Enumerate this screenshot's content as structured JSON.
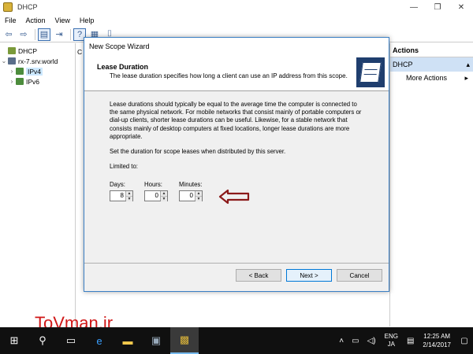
{
  "window": {
    "title": "DHCP",
    "controls": [
      "—",
      "❐",
      "✕"
    ]
  },
  "menu": [
    "File",
    "Action",
    "View",
    "Help"
  ],
  "tree": {
    "root": "DHCP",
    "server": "rx-7.srv.world",
    "children": [
      "IPv4",
      "IPv6"
    ]
  },
  "middle": {
    "header": "C"
  },
  "actions": {
    "title": "Actions",
    "section": "DHCP",
    "item": "More Actions"
  },
  "wizard": {
    "title": "New Scope Wizard",
    "heading": "Lease Duration",
    "subheading": "The lease duration specifies how long a client can use an IP address from this scope.",
    "paragraph1": "Lease durations should typically be equal to the average time the computer is connected to the same physical network. For mobile networks that consist mainly of portable computers or dial-up clients, shorter lease durations can be useful. Likewise, for a stable network that consists mainly of desktop computers at fixed locations, longer lease durations are more appropriate.",
    "paragraph2": "Set the duration for scope leases when distributed by this server.",
    "limited": "Limited to:",
    "fields": [
      {
        "label": "Days:",
        "value": "8"
      },
      {
        "label": "Hours:",
        "value": "0"
      },
      {
        "label": "Minutes:",
        "value": "0"
      }
    ],
    "buttons": {
      "back": "< Back",
      "next": "Next >",
      "cancel": "Cancel"
    }
  },
  "watermark": "ToVman.ir",
  "taskbar": {
    "lang1": "ENG",
    "lang2": "JA",
    "time": "12:25 AM",
    "date": "2/14/2017"
  },
  "colors": {
    "accent": "#0078d7",
    "annotation": "#8b1a1a",
    "watermark": "#d01818"
  }
}
